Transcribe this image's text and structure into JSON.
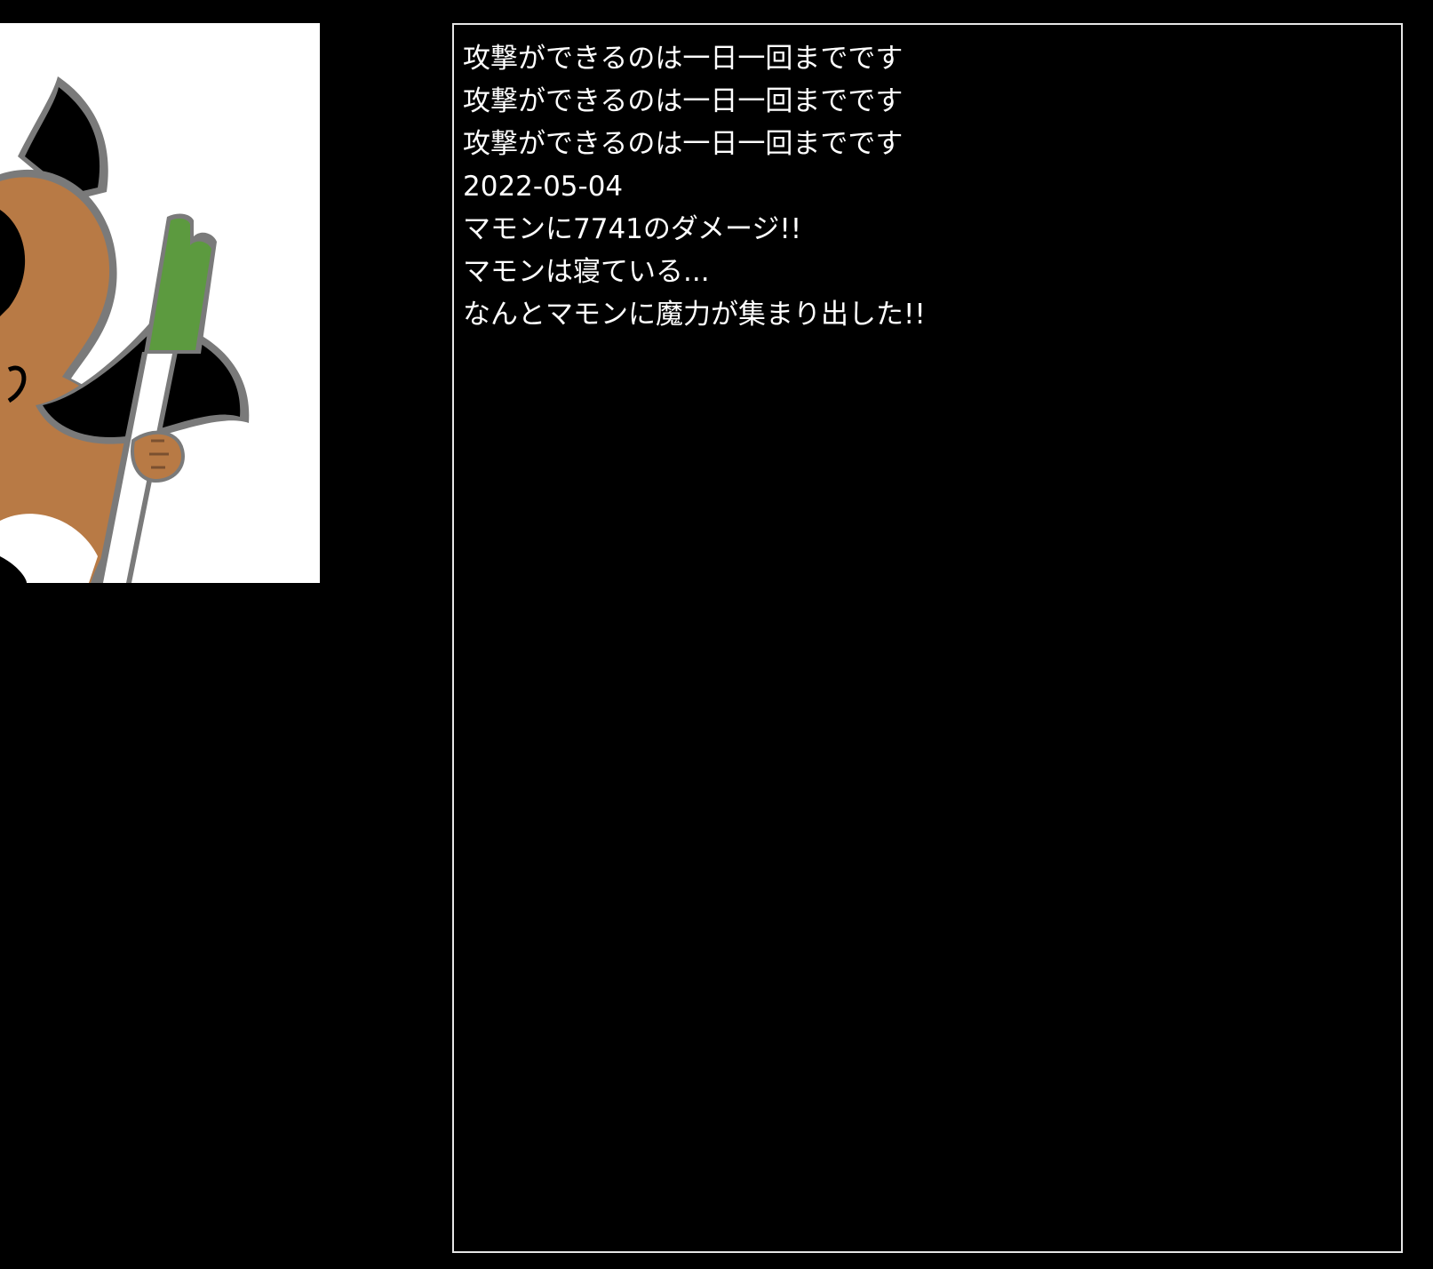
{
  "colors": {
    "background": "#000000",
    "log_text": "#ffffff",
    "log_border": "#e6e6e6",
    "monster_body": "#b87a45",
    "monster_dark": "#000000",
    "monster_outline": "#7a7a7a",
    "leek_green": "#5c9a3f",
    "leek_white": "#ffffff"
  },
  "monster": {
    "icon": "demon-with-leek-illustration"
  },
  "log": {
    "lines": [
      "攻撃ができるのは一日一回までです",
      "攻撃ができるのは一日一回までです",
      "攻撃ができるのは一日一回までです",
      "2022-05-04",
      "マモンに7741のダメージ!!",
      "マモンは寝ている...",
      "なんとマモンに魔力が集まり出した!!"
    ]
  }
}
